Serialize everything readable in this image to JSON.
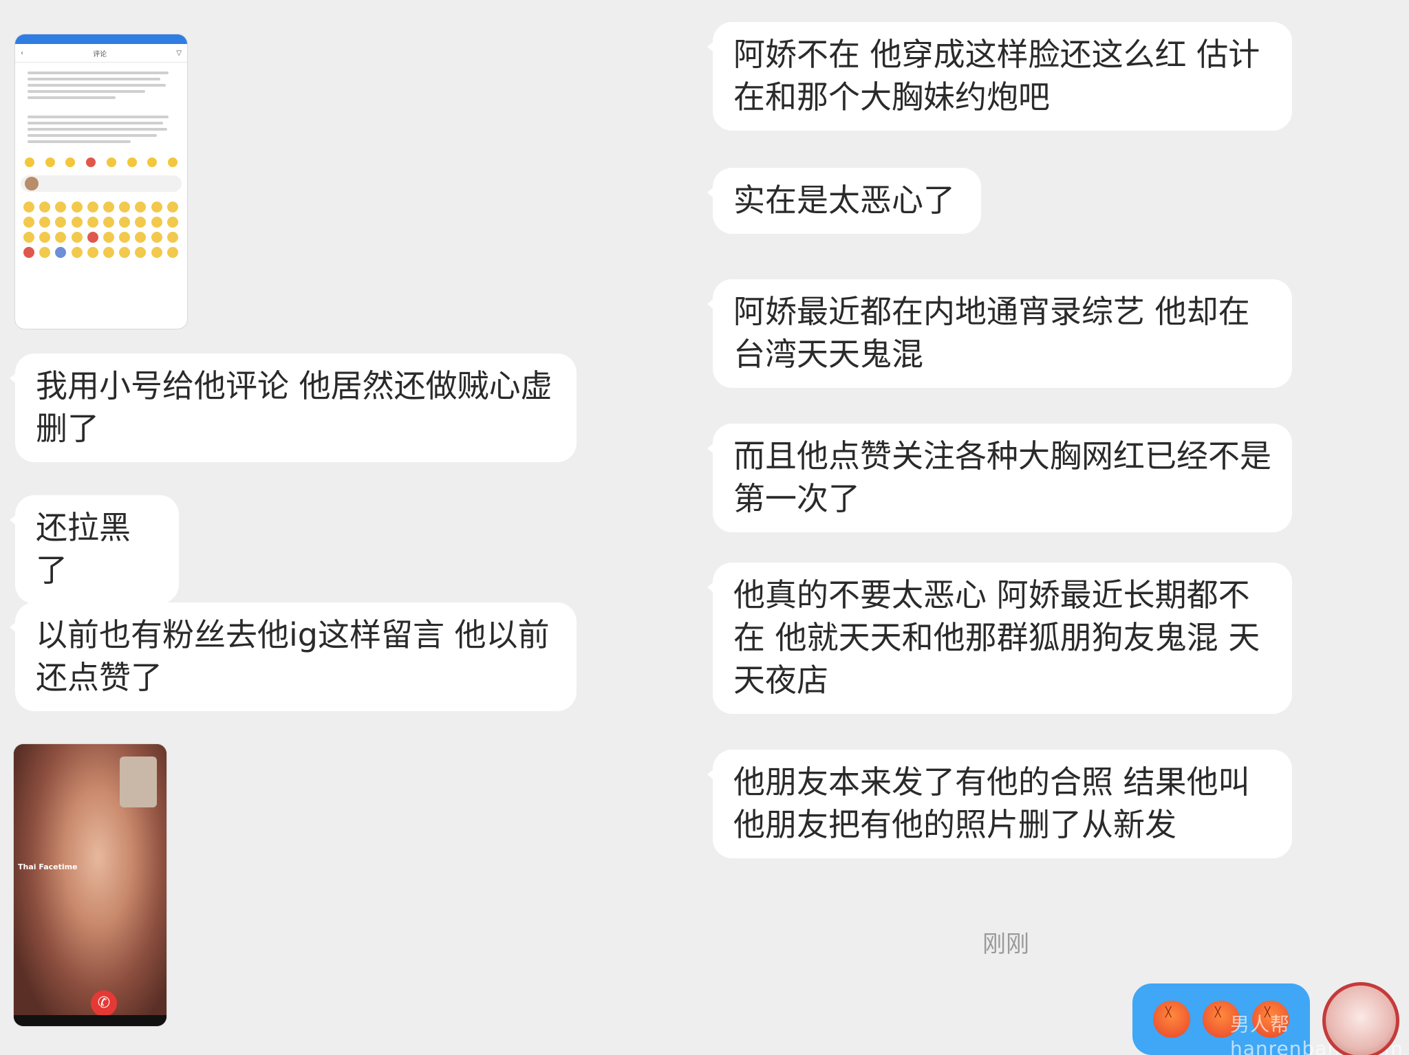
{
  "left_messages": [
    {
      "text": "我用小号给他评论 他居然还做贼心虚删了"
    },
    {
      "text": "还拉黑了"
    },
    {
      "text": "以前也有粉丝去他ig这样留言 他以前还点赞了"
    }
  ],
  "right_messages": [
    {
      "text": "阿娇不在 他穿成这样脸还这么红 估计在和那个大胸妹约炮吧"
    },
    {
      "text": "实在是太恶心了"
    },
    {
      "text": "阿娇最近都在内地通宵录综艺 他却在台湾天天鬼混"
    },
    {
      "text": "而且他点赞关注各种大胸网红已经不是第一次了"
    },
    {
      "text": "他真的不要太恶心 阿娇最近长期都不在 他就天天和他那群狐朋狗友鬼混 天天夜店"
    },
    {
      "text": "他朋友本来发了有他的合照 结果他叫他朋友把有他的照片删了从新发"
    }
  ],
  "timestamp": "刚刚",
  "screenshot_comments": {
    "title": "评论"
  },
  "screenshot_video": {
    "overlay": "Thai Facetime"
  },
  "sent_reaction": {
    "emoji_icon": "angry-face-icon",
    "count": 3,
    "bubble_color": "#3fa7f5"
  },
  "watermark": "男人帮hanrenbang.com"
}
